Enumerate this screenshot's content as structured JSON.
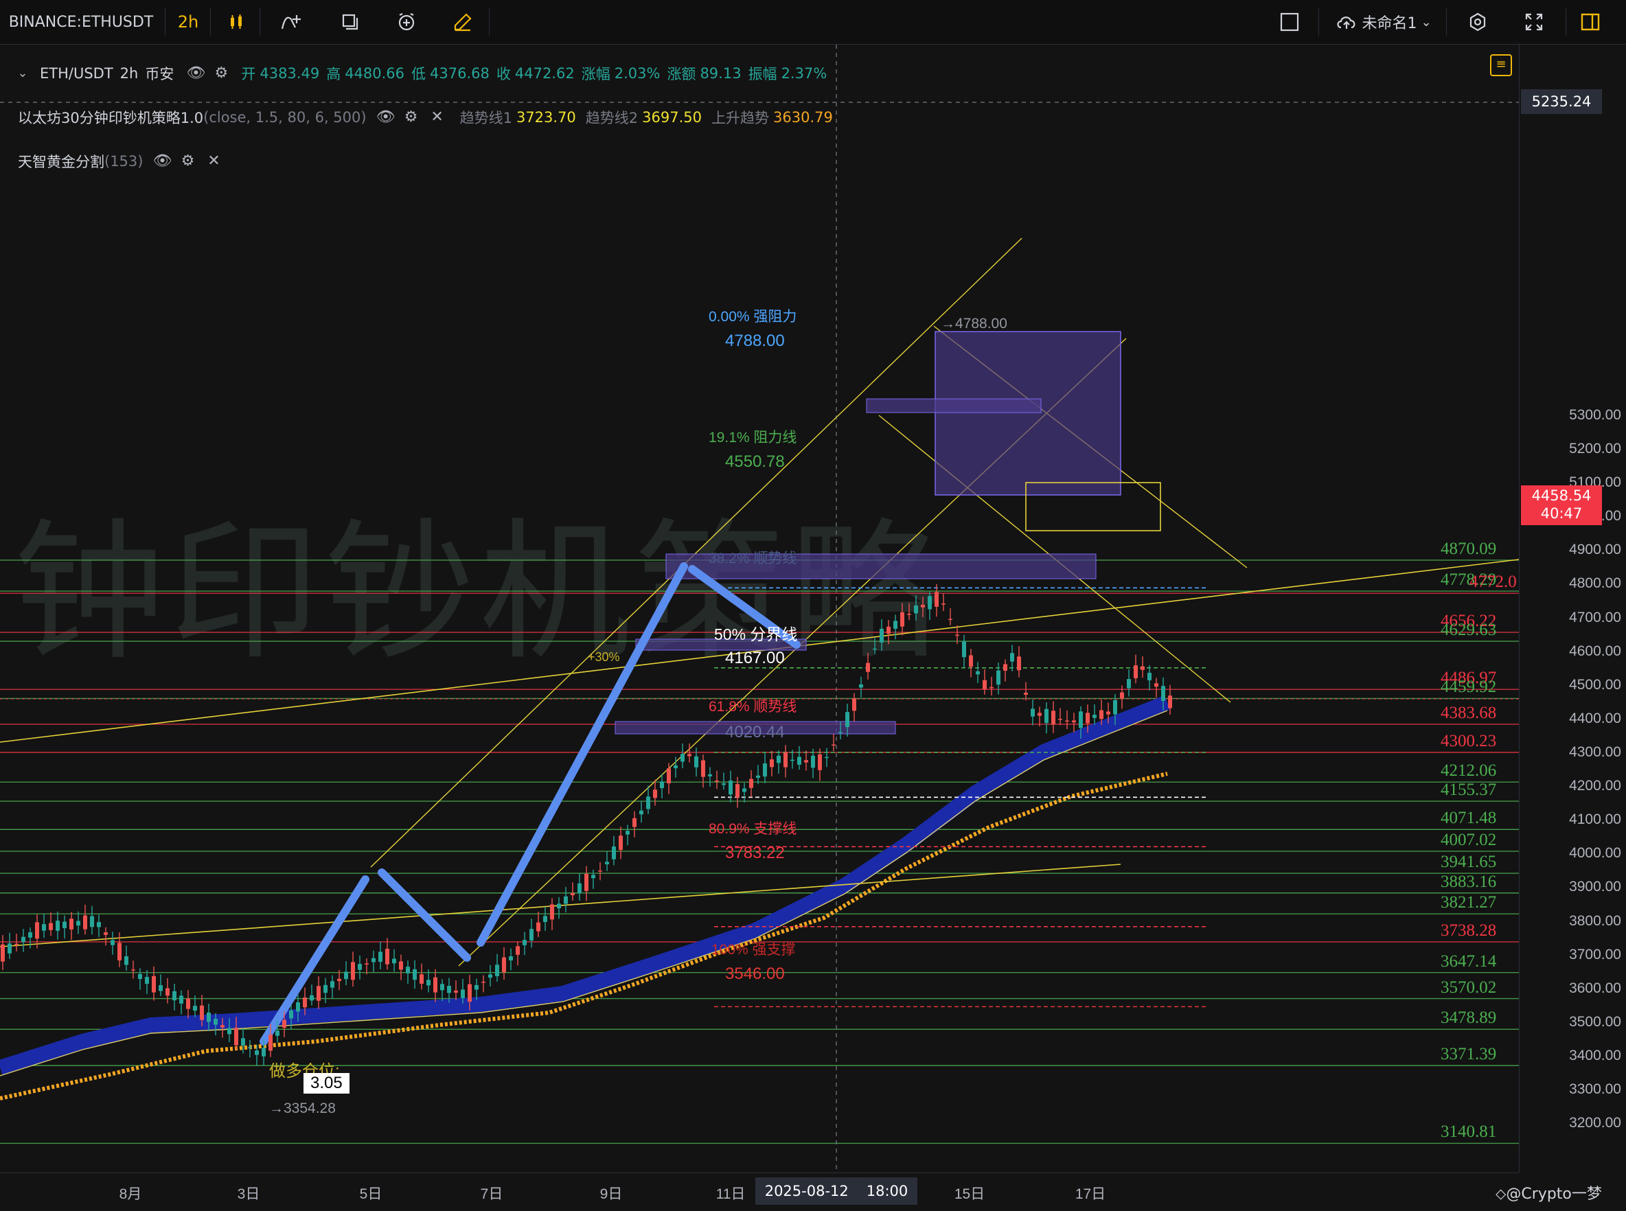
{
  "toolbar": {
    "symbol": "BINANCE:ETHUSDT",
    "interval": "2h",
    "layout_name": "未命名1",
    "icons": [
      "candles-icon",
      "indicators-icon",
      "compare-icon",
      "alert-icon",
      "drawing-icon",
      "rectangle-icon",
      "cloud-save-icon",
      "settings-icon",
      "fullscreen-icon",
      "sidebar-toggle-icon"
    ]
  },
  "legend": {
    "main": {
      "pair": "ETH/USDT",
      "interval": "2h",
      "exchange": "币安",
      "open_label": "开",
      "open": "4383.49",
      "high_label": "高",
      "high": "4480.66",
      "low_label": "低",
      "low": "4376.68",
      "close_label": "收",
      "close": "4472.62",
      "chg_pct_label": "涨幅",
      "chg_pct": "2.03%",
      "chg_label": "涨额",
      "chg": "89.13",
      "amp_label": "振幅",
      "amp": "2.37%"
    },
    "indicator1": {
      "name": "以太坊30分钟印钞机策略1.0",
      "params": "(close, 1.5, 80, 6, 500)",
      "t1_label": "趋势线1",
      "t1": "3723.70",
      "t2_label": "趋势线2",
      "t2": "3697.50",
      "up_label": "上升趋势",
      "up": "3630.79"
    },
    "indicator2": {
      "name": "天智黄金分割",
      "params": "(153)"
    }
  },
  "watermark": "钟印钞机策略",
  "price_axis": {
    "ticks": [
      "5300.00",
      "5200.00",
      "5100.00",
      "5000.00",
      "4900.00",
      "4800.00",
      "4700.00",
      "4600.00",
      "4500.00",
      "4400.00",
      "4300.00",
      "4200.00",
      "4100.00",
      "4000.00",
      "3900.00",
      "3800.00",
      "3700.00",
      "3600.00",
      "3500.00",
      "3400.00",
      "3300.00",
      "3200.00"
    ],
    "crosshair_price": "5235.24",
    "last_price": "4458.54",
    "countdown": "40:47"
  },
  "time_axis": {
    "ticks": [
      "8月",
      "3日",
      "5日",
      "7日",
      "9日",
      "11日",
      "15日",
      "17日"
    ],
    "crosshair_date": "2025-08-12",
    "crosshair_time": "18:00"
  },
  "levels_right": [
    {
      "text": "4870.09",
      "color": "#4caf50"
    },
    {
      "text": "4778.29",
      "color": "#4caf50"
    },
    {
      "text": "4772.0",
      "color": "#f23645"
    },
    {
      "text": "4656.22",
      "color": "#f23645"
    },
    {
      "text": "4629.63",
      "color": "#4caf50"
    },
    {
      "text": "4486.97",
      "color": "#f23645"
    },
    {
      "text": "4459.92",
      "color": "#4caf50"
    },
    {
      "text": "4383.68",
      "color": "#f23645"
    },
    {
      "text": "4300.23",
      "color": "#f23645"
    },
    {
      "text": "4212.06",
      "color": "#4caf50"
    },
    {
      "text": "4155.37",
      "color": "#4caf50"
    },
    {
      "text": "4071.48",
      "color": "#4caf50"
    },
    {
      "text": "4007.02",
      "color": "#4caf50"
    },
    {
      "text": "3941.65",
      "color": "#4caf50"
    },
    {
      "text": "3883.16",
      "color": "#4caf50"
    },
    {
      "text": "3821.27",
      "color": "#4caf50"
    },
    {
      "text": "3738.28",
      "color": "#f23645"
    },
    {
      "text": "3647.14",
      "color": "#4caf50"
    },
    {
      "text": "3570.02",
      "color": "#4caf50"
    },
    {
      "text": "3478.89",
      "color": "#4caf50"
    },
    {
      "text": "3371.39",
      "color": "#4caf50"
    },
    {
      "text": "3140.81",
      "color": "#4caf50"
    }
  ],
  "fib": {
    "l0": "0.00% 强阻力",
    "l0v": "4788.00",
    "l191": "19.1% 阻力线",
    "l191v": "4550.78",
    "l382": "38.2% 顺势线",
    "l50": "50% 分界线",
    "l50v": "4167.00",
    "l618": "61.8% 顺势线",
    "l618v": "4020.44",
    "l809": "80.9% 支撑线",
    "l809v": "3783.22",
    "l100": "100% 强支撑",
    "l100v": "3546.00",
    "top_arrow": "→4788.00",
    "low_arrow": "→3354.28",
    "pct30": "+30%",
    "long_pos_label": "做多仓位:",
    "long_pos_value": "3.05"
  },
  "credit": "@Crypto一梦",
  "colors": {
    "up": "#26a69a",
    "down": "#ef5350",
    "accent": "#f0b90b",
    "blue_band": "#1a2aa8",
    "orange_ma": "#f5a623"
  }
}
